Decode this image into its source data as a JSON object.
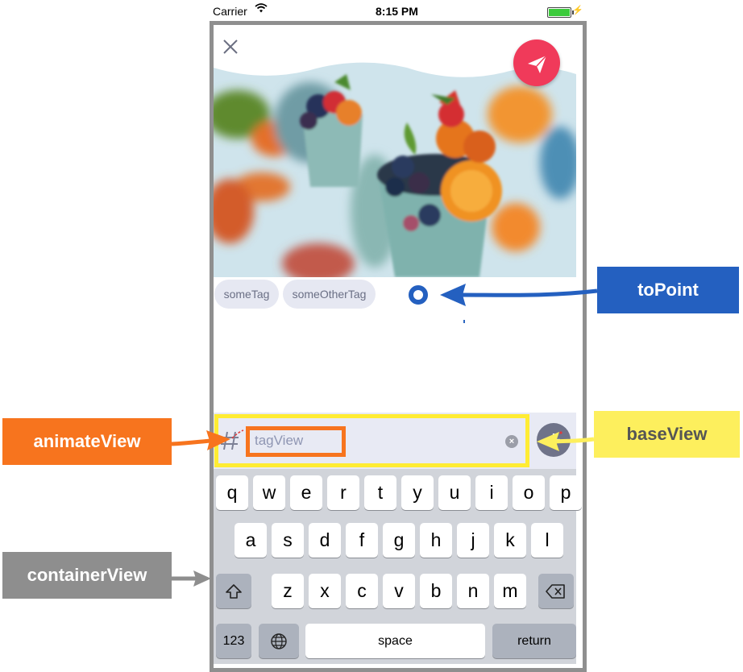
{
  "status_bar": {
    "carrier": "Carrier",
    "time": "8:15 PM"
  },
  "tags": [
    "someTag",
    "someOtherTag"
  ],
  "input": {
    "value": "tagView",
    "clear_glyph": "×"
  },
  "keyboard": {
    "row1": [
      "q",
      "w",
      "e",
      "r",
      "t",
      "y",
      "u",
      "i",
      "o",
      "p"
    ],
    "row2": [
      "a",
      "s",
      "d",
      "f",
      "g",
      "h",
      "j",
      "k",
      "l"
    ],
    "row3": [
      "z",
      "x",
      "c",
      "v",
      "b",
      "n",
      "m"
    ],
    "numbers": "123",
    "space": "space",
    "return": "return"
  },
  "annotations": {
    "to_point": "toPoint",
    "base_view": "baseView",
    "animate_view": "animateView",
    "container_view": "containerView"
  },
  "colors": {
    "to_point": "#2460c0",
    "base_view": "#ffec33",
    "animate_view": "#f7741e",
    "container_view": "#8e8e8e",
    "send_button": "#f03a5a"
  },
  "icons": [
    "wifi-icon",
    "battery-icon",
    "close-icon",
    "send-icon",
    "hashtag-icon",
    "clear-icon",
    "add-button",
    "shift-icon",
    "backspace-icon",
    "globe-icon"
  ]
}
